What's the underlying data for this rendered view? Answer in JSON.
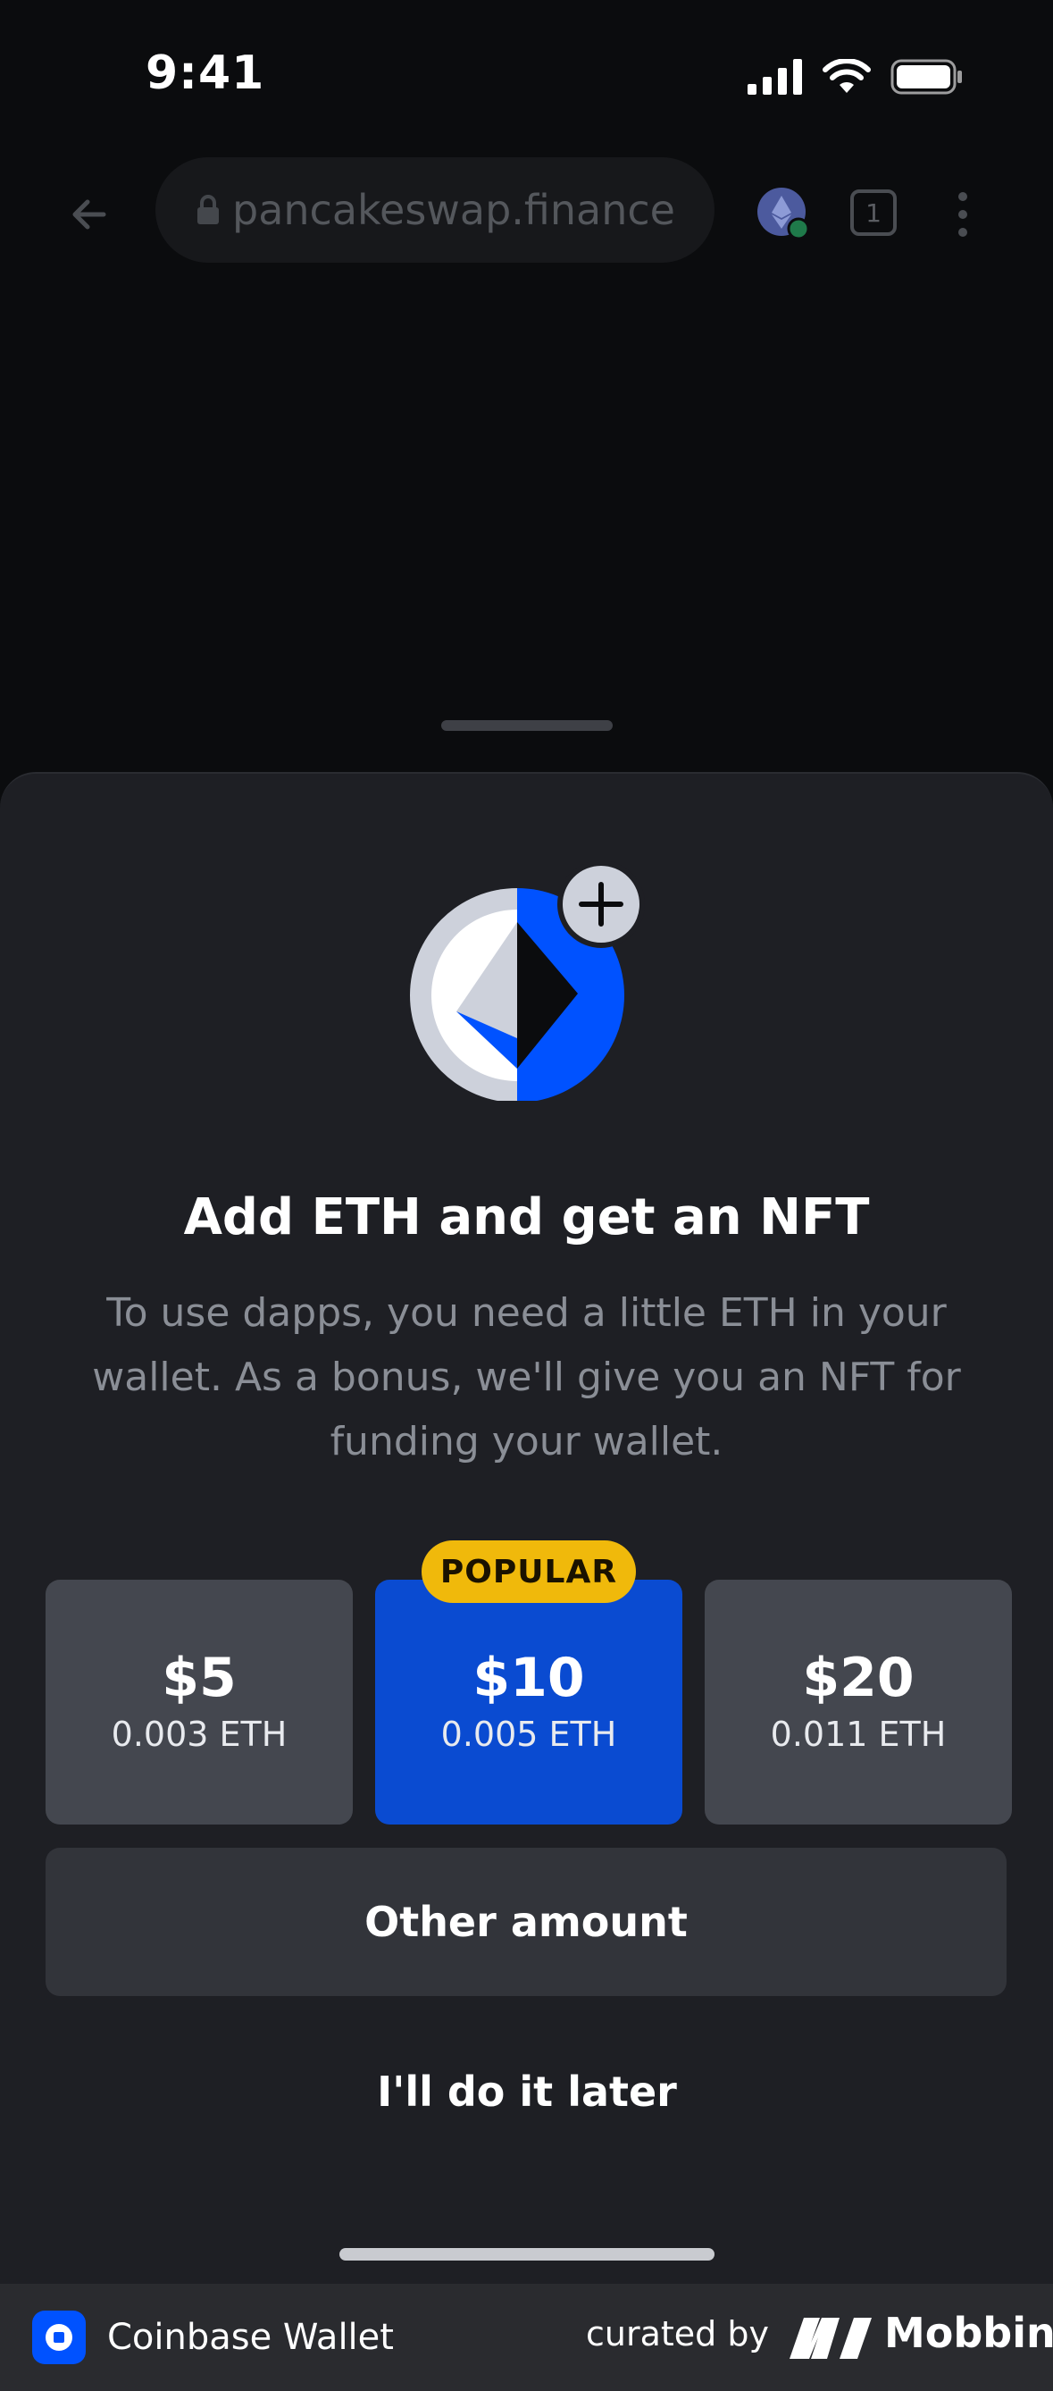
{
  "status_bar": {
    "time": "9:41"
  },
  "browser": {
    "url": "pancakeswap.finance",
    "tab_count": "1"
  },
  "sheet": {
    "title": "Add ETH and get an NFT",
    "subtitle": "To use dapps, you need a little ETH in your wallet. As a bonus, we'll give you an NFT for funding your wallet.",
    "badge": "POPULAR",
    "amounts": [
      {
        "value": "$5",
        "eth": "0.003 ETH"
      },
      {
        "value": "$10",
        "eth": "0.005 ETH"
      },
      {
        "value": "$20",
        "eth": "0.011 ETH"
      }
    ],
    "other_amount": "Other amount",
    "later": "I'll do it later"
  },
  "footer": {
    "app_name": "Coinbase Wallet",
    "curated_by": "curated by",
    "brand": "Mobbin"
  },
  "colors": {
    "accent": "#0a4bd1",
    "badge": "#f0b90b",
    "sheet": "#1e1f24"
  }
}
